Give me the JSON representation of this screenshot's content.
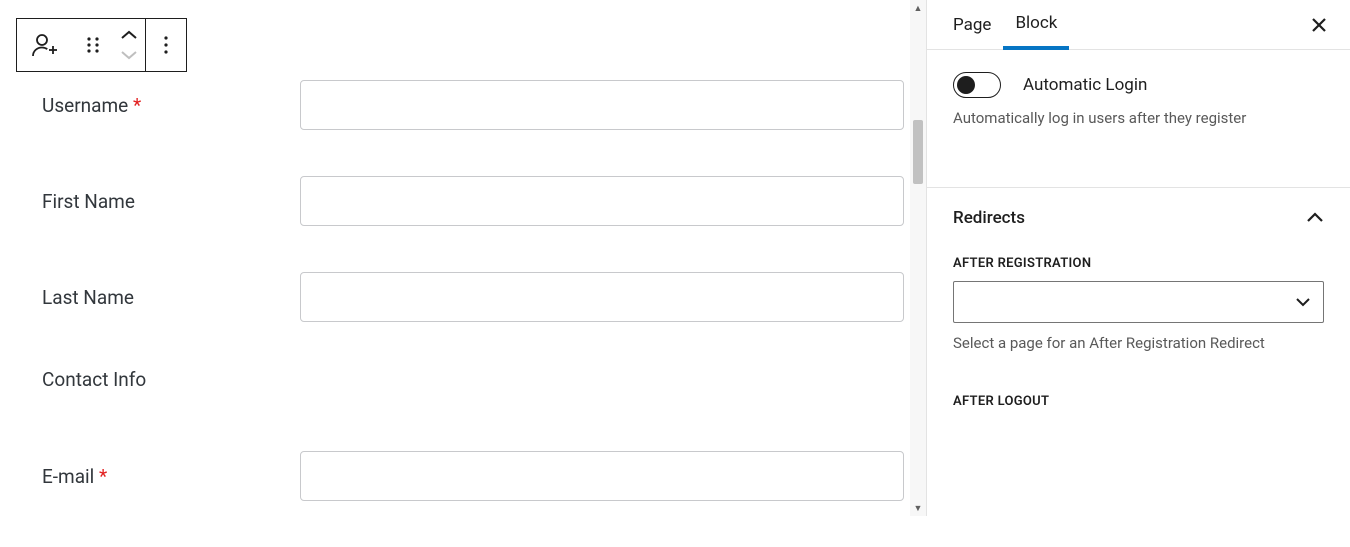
{
  "inspector": {
    "tabs": {
      "page": "Page",
      "block": "Block"
    },
    "auto_login": {
      "label": "Automatic Login",
      "help": "Automatically log in users after they register"
    },
    "redirects": {
      "title": "Redirects",
      "after_registration": {
        "caption": "After Registration",
        "help": "Select a page for an After Registration Redirect"
      },
      "after_logout": {
        "caption": "After Logout"
      }
    }
  },
  "form": {
    "fields": {
      "username": {
        "label": "Username",
        "required": "*"
      },
      "first_name": {
        "label": "First Name"
      },
      "last_name": {
        "label": "Last Name"
      },
      "contact_info": {
        "label": "Contact Info"
      },
      "email": {
        "label": "E-mail",
        "required": "*"
      }
    }
  }
}
